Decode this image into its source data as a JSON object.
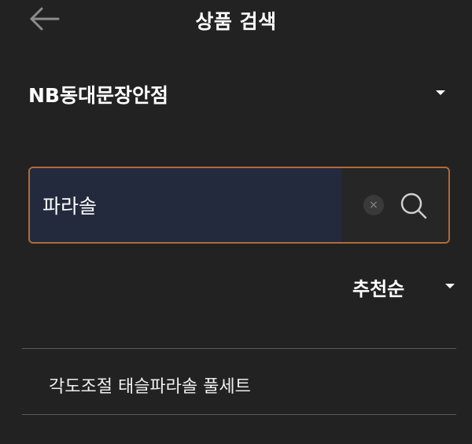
{
  "header": {
    "title": "상품 검색",
    "back_icon": "arrow-left-icon"
  },
  "store_selector": {
    "name": "NB동대문장안점",
    "icon": "caret-down-icon"
  },
  "search": {
    "value": "파라솔",
    "clear_icon": "clear-x-icon",
    "clear_symbol": "×",
    "search_icon": "magnifier-icon"
  },
  "sort": {
    "label": "추천순",
    "icon": "caret-down-icon"
  },
  "results": [
    {
      "label": "각도조절 태슬파라솔 풀세트"
    }
  ],
  "colors": {
    "background": "#222222",
    "input_fill": "#232a3e",
    "search_border": "#b06a3a",
    "divider": "#5a5a5a",
    "text": "#ffffff"
  }
}
